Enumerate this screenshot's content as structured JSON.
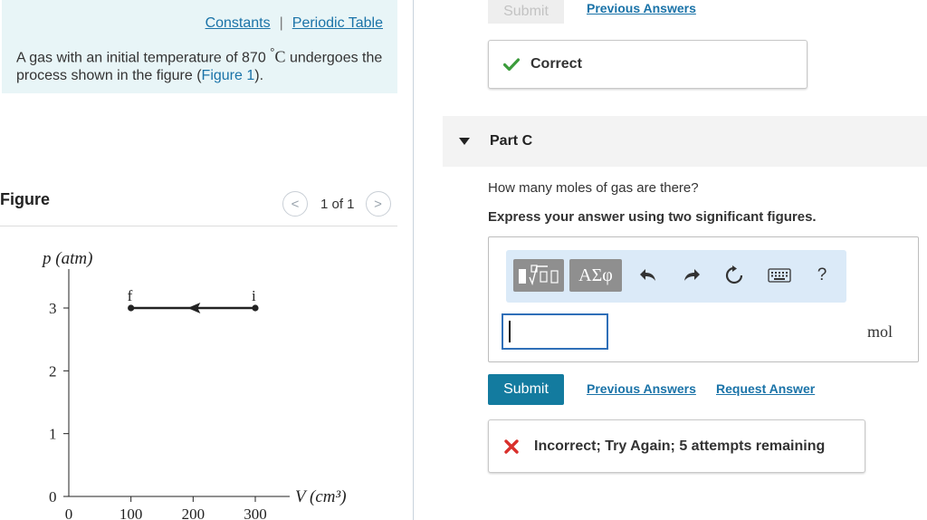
{
  "header": {
    "constants_link": "Constants",
    "separator": "|",
    "periodic_link": "Periodic Table"
  },
  "problem": {
    "text_before": "A gas with an initial temperature of 870 ",
    "degree": "°",
    "unit_c": "C",
    "text_after": " undergoes the process shown in the figure (",
    "figure_link": "Figure 1",
    "text_end": ")."
  },
  "figure": {
    "title": "Figure",
    "pager_prev": "<",
    "pager_count": "1 of 1",
    "pager_next": ">"
  },
  "chart_data": {
    "type": "line",
    "title": "",
    "xlabel": "V (cm³)",
    "ylabel": "p (atm)",
    "x_ticks": [
      "0",
      "100",
      "200",
      "300"
    ],
    "y_ticks": [
      "0",
      "1",
      "2",
      "3"
    ],
    "xlim": [
      0,
      300
    ],
    "ylim": [
      0,
      3
    ],
    "series": [
      {
        "points": [
          {
            "x": 300,
            "y": 3,
            "label": "i"
          },
          {
            "x": 100,
            "y": 3,
            "label": "f"
          }
        ]
      }
    ],
    "arrow_direction": "from i to f",
    "grid": false
  },
  "previous_part": {
    "submit_label": "Submit",
    "previous_answers": "Previous Answers",
    "feedback": "Correct"
  },
  "part_c": {
    "label": "Part C",
    "question": "How many moles of gas are there?",
    "instruction": "Express your answer using two significant figures.",
    "toolbar": {
      "greek_label": "ΑΣφ",
      "help_label": "?"
    },
    "answer_value": "",
    "unit": "mol",
    "submit_label": "Submit",
    "previous_answers": "Previous Answers",
    "request_answer": "Request Answer",
    "feedback": "Incorrect; Try Again; 5 attempts remaining"
  },
  "colors": {
    "info_bg": "#e8f5f7",
    "link": "#1a73a8",
    "submit_bg": "#137b9f",
    "correct_green": "#3c9c3c",
    "incorrect_red": "#d9302c"
  }
}
